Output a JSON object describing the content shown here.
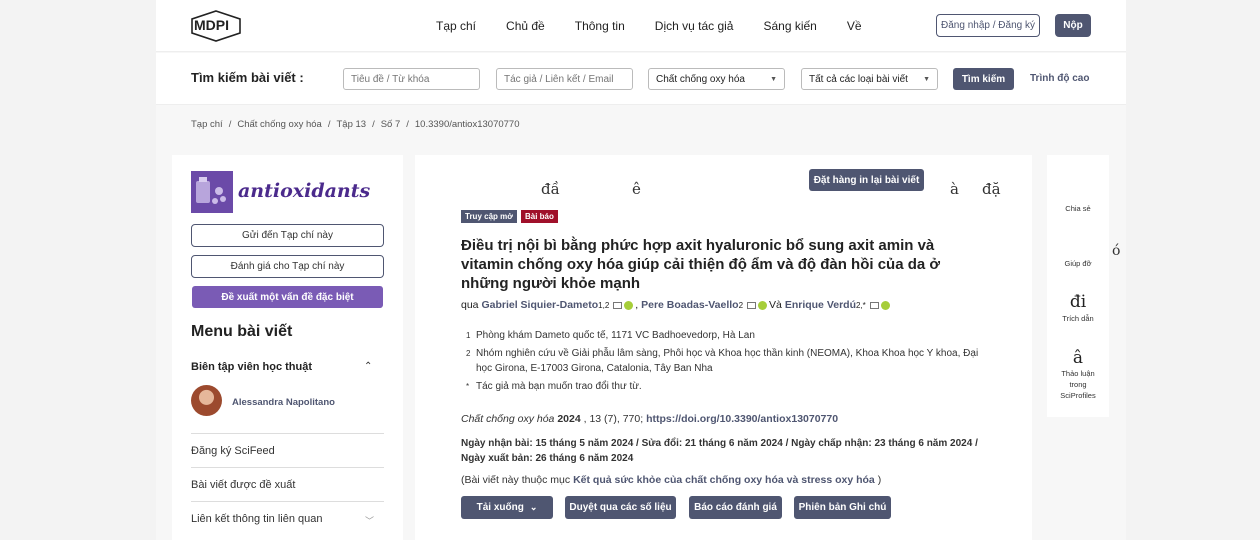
{
  "header": {
    "logo_text": "MDPI",
    "nav": [
      "Tạp chí",
      "Chủ đề",
      "Thông tin",
      "Dịch vụ tác giả",
      "Sáng kiến",
      "Về"
    ],
    "login_label": "Đăng nhập / Đăng ký",
    "submit_label": "Nộp"
  },
  "search": {
    "label": "Tìm kiếm bài viết :",
    "title_placeholder": "Tiêu đề / Từ khóa",
    "author_placeholder": "Tác giả / Liên kết / Email",
    "journal_select": "Chất chống oxy hóa",
    "type_select": "Tất cả các loại bài viết",
    "search_button": "Tìm kiếm",
    "advanced_link": "Trình độ cao"
  },
  "breadcrumb": [
    "Tạp chí",
    "/",
    "Chất chống oxy hóa",
    "/",
    "Tập 13",
    "/",
    "Số 7",
    "/",
    "10.3390/antiox13070770"
  ],
  "left_sidebar": {
    "journal_name": "antioxidants",
    "send_button": "Gửi đến Tạp chí này",
    "review_button": "Đánh giá cho Tạp chí này",
    "propose_button": "Đề xuất một vấn đề đặc biệt",
    "menu_title": "Menu bài viết",
    "editor_heading": "Biên tập viên học thuật",
    "editor_name": "Alessandra Napolitano",
    "menu_items": [
      "Đăng ký SciFeed",
      "Bài viết được đề xuất",
      "Liên kết thông tin liên quan"
    ]
  },
  "article": {
    "ghost_chars": [
      "đầ",
      "ê",
      "à",
      "đặ"
    ],
    "reprint_button": "Đặt hàng in lại bài viết",
    "badge_open": "Truy cập mở",
    "badge_type": "Bài báo",
    "title": "Điều trị nội bì bằng phức hợp axit hyaluronic bổ sung axit amin và vitamin chống oxy hóa giúp cải thiện độ ẩm và độ đàn hồi của da ở những người khỏe mạnh",
    "by": "qua",
    "author1": "Gabriel Siquier-Dameto",
    "author1_sup": "1,2",
    "author2": "Pere Boadas-Vaello",
    "author2_sup": "2",
    "and": "Và",
    "author3": "Enrique Verdú",
    "author3_sup": "2,*",
    "affiliations": [
      {
        "n": "1",
        "text": "Phòng khám Dameto quốc tế, 1171 VC Badhoevedorp, Hà Lan"
      },
      {
        "n": "2",
        "text": "Nhóm nghiên cứu về Giải phẫu lâm sàng, Phôi học và Khoa học thần kinh (NEOMA), Khoa Khoa học Y khoa, Đại học Girona, E-17003 Girona, Catalonia, Tây Ban Nha"
      },
      {
        "n": "*",
        "text": "Tác giả mà bạn muốn trao đổi thư từ."
      }
    ],
    "cite_journal": "Chất chống oxy hóa",
    "cite_year": "2024",
    "cite_rest": ", 13 (7), 770;",
    "cite_doi": "https://doi.org/10.3390/antiox13070770",
    "dates": "Ngày nhận bài: 15 tháng 5 năm 2024 / Sửa đổi: 21 tháng 6 năm 2024 / Ngày chấp nhận: 23 tháng 6 năm 2024 / Ngày xuất bản: 26 tháng 6 năm 2024",
    "section_prefix": "(Bài viết này thuộc mục",
    "section_link": "Kết quả sức khỏe của chất chống oxy hóa và stress oxy hóa",
    "section_suffix": ")",
    "buttons": [
      "Tải xuống",
      "Duyệt qua các số liệu",
      "Báo cáo đánh giá",
      "Phiên bản Ghi chú"
    ]
  },
  "right_sidebar": {
    "share": "Chia sẻ",
    "help": "Giúp đỡ",
    "cite_glyph": "đi",
    "cite": "Trích dẫn",
    "discuss_glyph": "â",
    "discuss": "Thảo luận trong SciProfiles"
  },
  "stray_char": "ó"
}
